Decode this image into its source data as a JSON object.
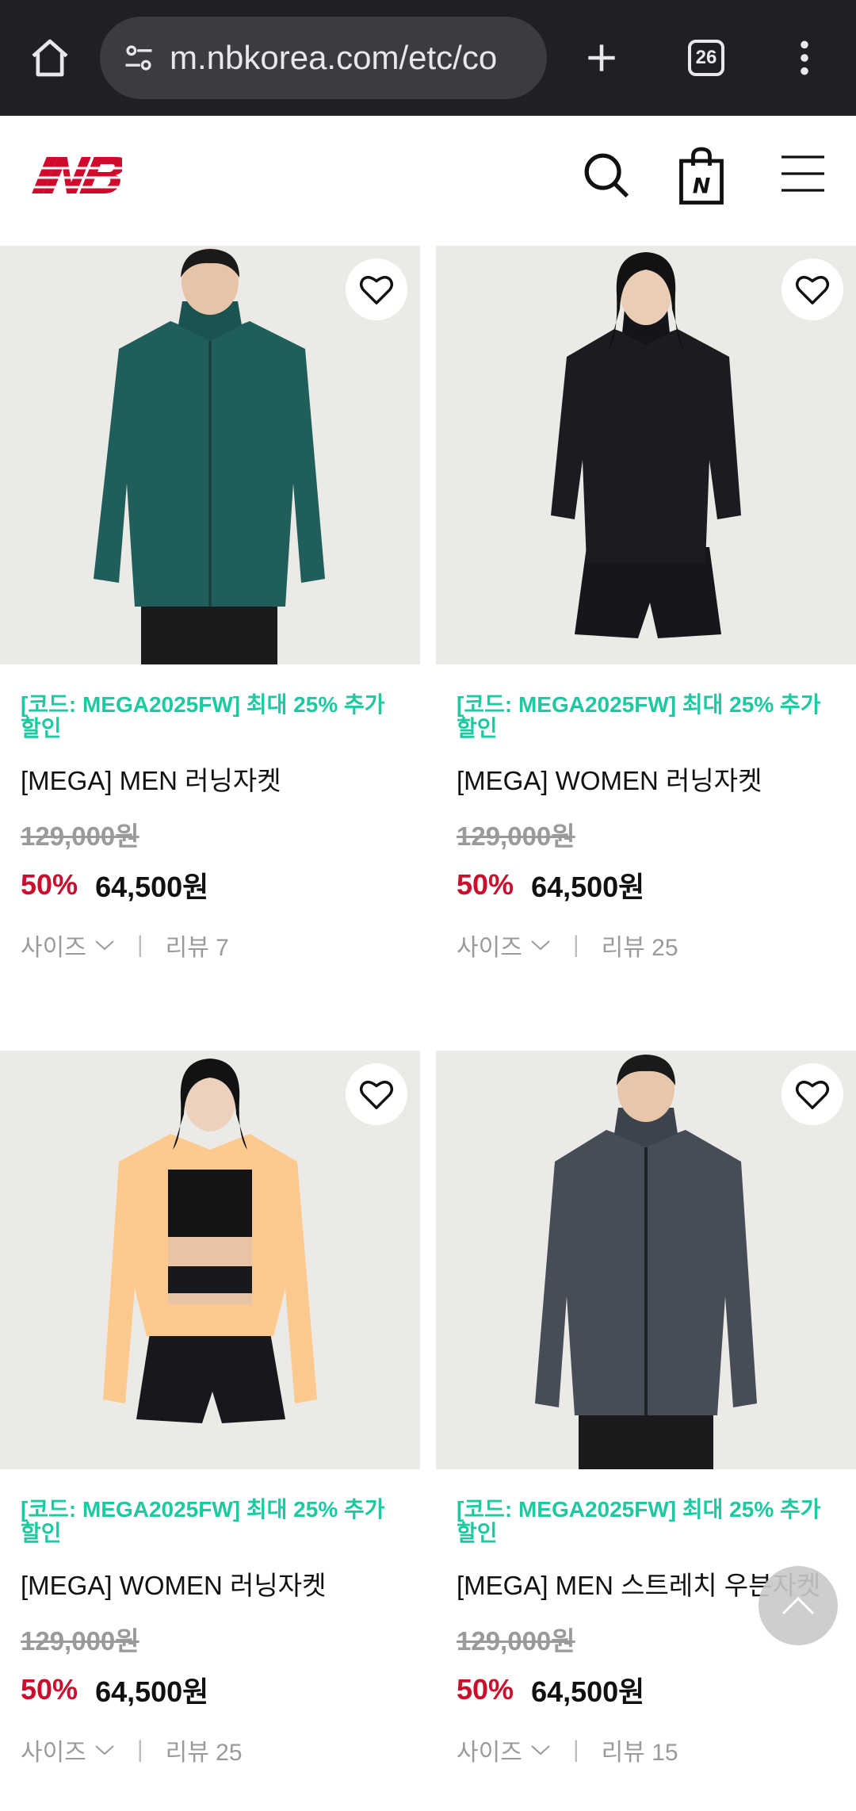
{
  "browser": {
    "url": "m.nbkorea.com/etc/co",
    "tab_count": "26"
  },
  "header": {
    "brand_color": "#cf0a2c"
  },
  "products": [
    {
      "promo": "[코드: MEGA2025FW] 최대 25% 추가할인",
      "name": "[MEGA] MEN 러닝자켓",
      "original_price": "129,000원",
      "discount": "50%",
      "price": "64,500원",
      "size_label": "사이즈",
      "review_label": "리뷰 7",
      "jacket_color": "#1f5e5a",
      "figure": "male"
    },
    {
      "promo": "[코드: MEGA2025FW] 최대 25% 추가할인",
      "name": "[MEGA] WOMEN 러닝자켓",
      "original_price": "129,000원",
      "discount": "50%",
      "price": "64,500원",
      "size_label": "사이즈",
      "review_label": "리뷰 25",
      "jacket_color": "#1b1c20",
      "figure": "female"
    },
    {
      "promo": "[코드: MEGA2025FW] 최대 25% 추가할인",
      "name": "[MEGA] WOMEN 러닝자켓",
      "original_price": "129,000원",
      "discount": "50%",
      "price": "64,500원",
      "size_label": "사이즈",
      "review_label": "리뷰 25",
      "jacket_color": "#fcc98e",
      "figure": "female"
    },
    {
      "promo": "[코드: MEGA2025FW] 최대 25% 추가할인",
      "name": "[MEGA] MEN 스트레치 우븐자켓",
      "original_price": "129,000원",
      "discount": "50%",
      "price": "64,500원",
      "size_label": "사이즈",
      "review_label": "리뷰 15",
      "jacket_color": "#464d57",
      "figure": "male"
    }
  ],
  "colors": {
    "promo": "#1dc9a0",
    "discount": "#c8102e"
  }
}
